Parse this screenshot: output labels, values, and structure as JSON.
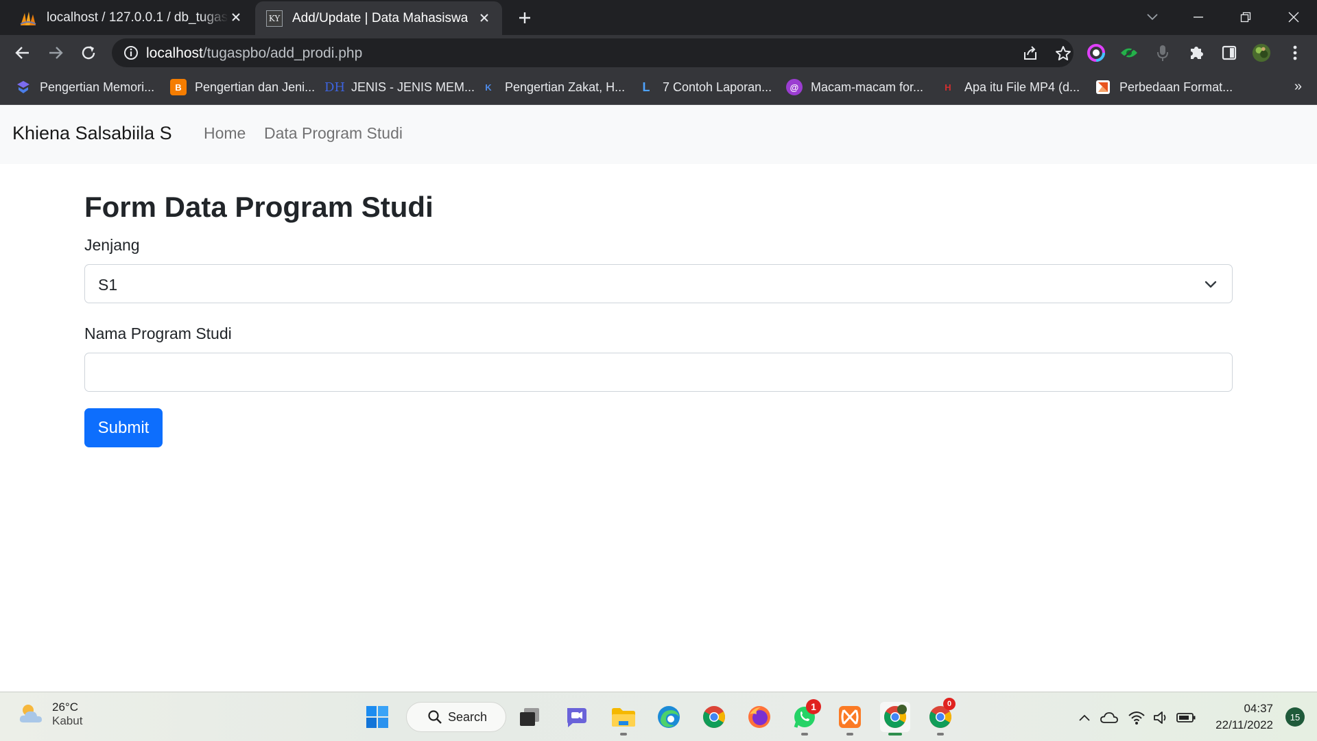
{
  "browser": {
    "tabs": [
      {
        "title": "localhost / 127.0.0.1 / db_tugaspbo",
        "active": false
      },
      {
        "title": "Add/Update | Data Mahasiswa",
        "favicon_text": "KY",
        "active": true
      }
    ],
    "address": {
      "host": "localhost",
      "path": "/tugaspbo/add_prodi.php"
    },
    "bookmarks": [
      {
        "label": "Pengertian Memori...",
        "color": "#6a5be2"
      },
      {
        "label": "Pengertian dan Jeni...",
        "color": "#f57d00",
        "icon_text": "B"
      },
      {
        "label": "JENIS - JENIS MEM...",
        "color": "#1c3b9e",
        "icon_text": "DH"
      },
      {
        "label": "Pengertian Zakat, H...",
        "color": "#2d5fb8",
        "icon_text": "K"
      },
      {
        "label": "7 Contoh Laporan...",
        "color": "#1a73e8",
        "icon_text": "L"
      },
      {
        "label": "Macam-macam for...",
        "color": "#9b3dd1",
        "icon_text": "@"
      },
      {
        "label": "Apa itu File MP4 (d...",
        "color": "#c62828",
        "icon_text": "H"
      },
      {
        "label": "Perbedaan Format...",
        "color": "#e8551f"
      }
    ],
    "bookmarks_more": "»"
  },
  "navbar": {
    "brand": "Khiena Salsabiila S",
    "links": [
      "Home",
      "Data Program Studi"
    ]
  },
  "form": {
    "title": "Form Data Program Studi",
    "jenjang_label": "Jenjang",
    "jenjang_value": "S1",
    "nama_label": "Nama Program Studi",
    "nama_value": "",
    "submit_label": "Submit"
  },
  "taskbar": {
    "weather_temp": "26°C",
    "weather_cond": "Kabut",
    "search_label": "Search",
    "whatsapp_badge": "1",
    "chrome2_badge": "0",
    "time": "04:37",
    "date": "22/11/2022",
    "notifications": "15"
  },
  "colors": {
    "primary": "#0d6efd",
    "navbar_bg": "#f8f9fa",
    "chrome_dark": "#202124",
    "chrome_toolbar": "#35363a"
  }
}
